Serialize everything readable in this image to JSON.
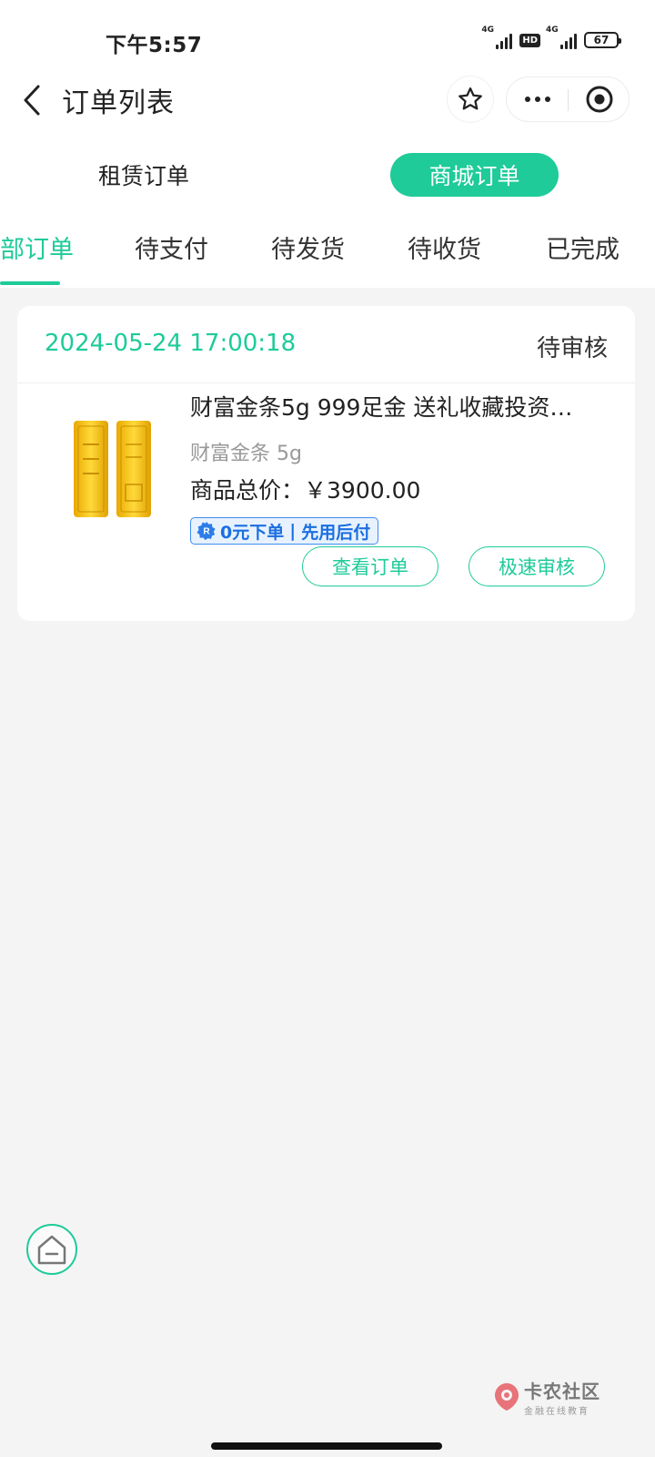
{
  "status_bar": {
    "time": "下午5:57",
    "network1": "4G",
    "hd": "HD",
    "network2": "4G",
    "battery": "67"
  },
  "header": {
    "title": "订单列表"
  },
  "order_type_switch": {
    "rental": "租赁订单",
    "mall": "商城订单",
    "active": "mall"
  },
  "status_tabs": [
    {
      "label": "部订单",
      "active": true
    },
    {
      "label": "待支付",
      "active": false
    },
    {
      "label": "待发货",
      "active": false
    },
    {
      "label": "待收货",
      "active": false
    },
    {
      "label": "已完成",
      "active": false
    }
  ],
  "order": {
    "datetime": "2024-05-24 17:00:18",
    "status": "待审核",
    "product_title": "财富金条5g 999足金 送礼收藏投资…",
    "spec": "财富金条 5g",
    "price_label": "商品总价：",
    "price_value": "￥3900.00",
    "promo_left": "0元下单",
    "promo_sep": "|",
    "promo_right": "先用后付",
    "view_order": "查看订单",
    "fast_review": "极速审核"
  },
  "watermark": {
    "title": "卡农社区",
    "subtitle": "金融在线教育"
  },
  "colors": {
    "accent": "#1ecb99",
    "promo_blue": "#1b6fe0",
    "gold": "#f2c20a"
  }
}
